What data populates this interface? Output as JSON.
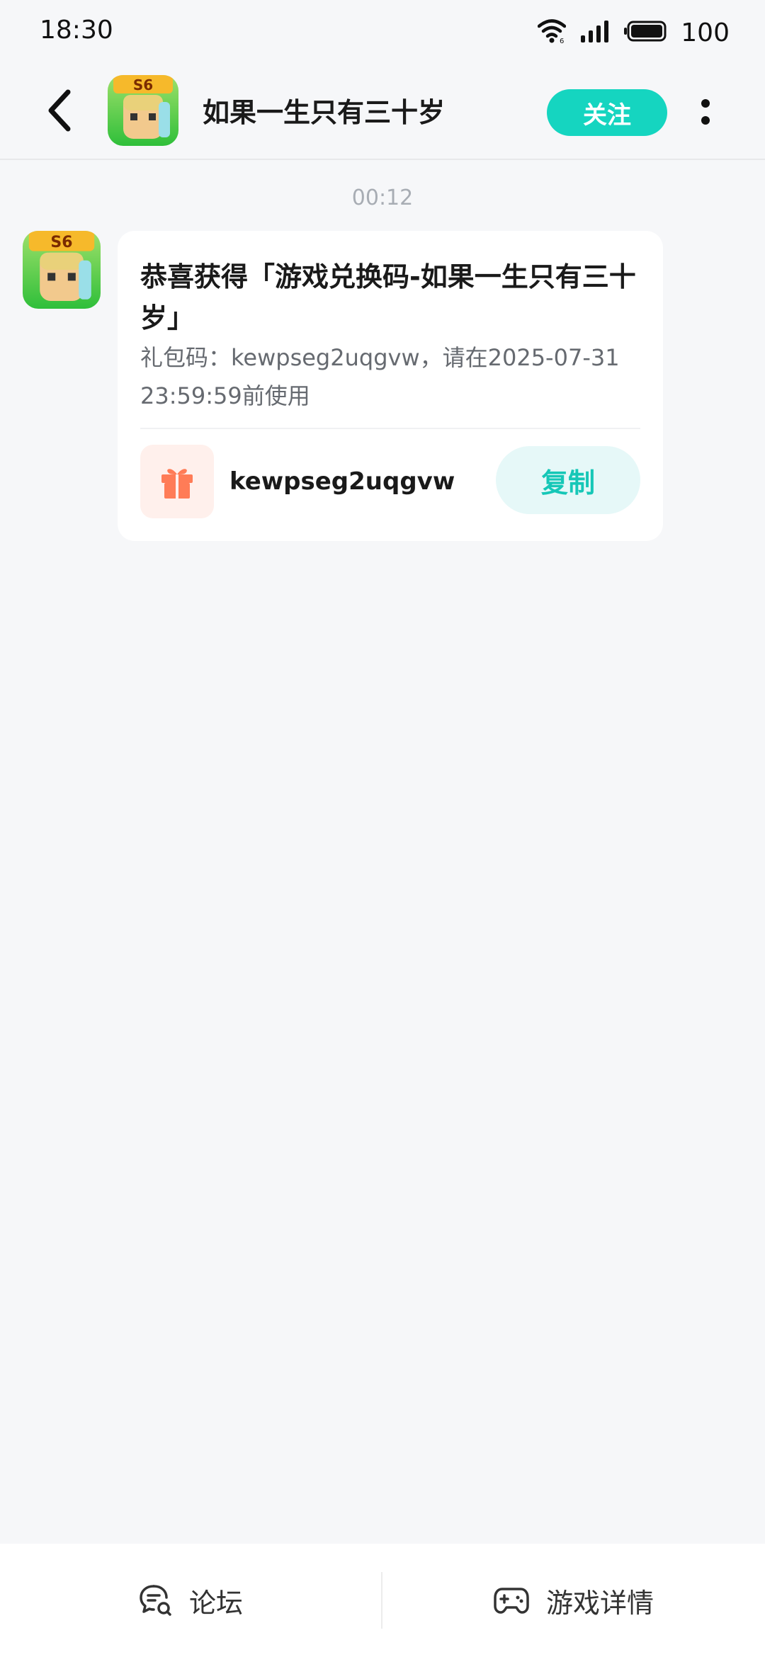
{
  "status_bar": {
    "time": "18:30",
    "battery": "100",
    "icons": [
      "wifi-icon",
      "signal-icon",
      "battery-icon"
    ]
  },
  "header": {
    "title": "如果一生只有三十岁",
    "follow_label": "关注",
    "back_icon": "chevron-left-icon",
    "more_icon": "more-vertical-icon",
    "accent_color": "#15d5c0"
  },
  "chat": {
    "timestamp": "00:12",
    "message": {
      "headline": "恭喜获得「游戏兑换码-如果一生只有三十岁」",
      "description": "礼包码：kewpseg2uqgvw，请在2025-07-31 23:59:59前使用",
      "code": "kewpseg2uqgvw",
      "copy_label": "复制",
      "gift_icon": "gift-icon"
    }
  },
  "bottom_bar": {
    "forum_label": "论坛",
    "forum_icon": "forum-chat-icon",
    "game_details_label": "游戏详情",
    "game_details_icon": "gamepad-icon"
  }
}
